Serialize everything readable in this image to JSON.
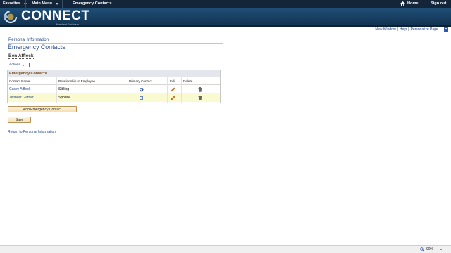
{
  "topbar": {
    "favorites": "Favorites",
    "main_menu": "Main Menu",
    "breadcrumb_current": "Emergency Contacts",
    "home": "Home",
    "sign_out": "Sign out"
  },
  "banner": {
    "logo": "CONNECT",
    "subtitle": "Maryland Judiciary"
  },
  "utility_links": {
    "new_window": "New Window",
    "help": "Help",
    "personalize": "Personalize Page",
    "separator": "|"
  },
  "page": {
    "section": "Personal Information",
    "title": "Emergency Contacts",
    "employee_name": "Ben Affleck",
    "actions_label": "Actions"
  },
  "grid": {
    "title": "Emergency Contacts",
    "columns": {
      "name": "Contact Name",
      "relationship": "Relationship to Employee",
      "primary": "Primary Contact",
      "edit": "Edit",
      "delete": "Delete"
    },
    "rows": [
      {
        "name": "Casey Affleck",
        "relationship": "Sibling",
        "primary": true
      },
      {
        "name": "Jennifer Garner",
        "relationship": "Spouse",
        "primary": false
      }
    ]
  },
  "buttons": {
    "add": "Add Emergency Contact",
    "save": "Save"
  },
  "links": {
    "return": "Return to Personal Information"
  },
  "status": {
    "zoom": "90%"
  },
  "colors": {
    "topbar": "#14253a",
    "banner": "#1f4f78",
    "link": "#1a3c8a",
    "grid_title_text": "#7a4b1a",
    "alt_row": "#fafad0"
  }
}
